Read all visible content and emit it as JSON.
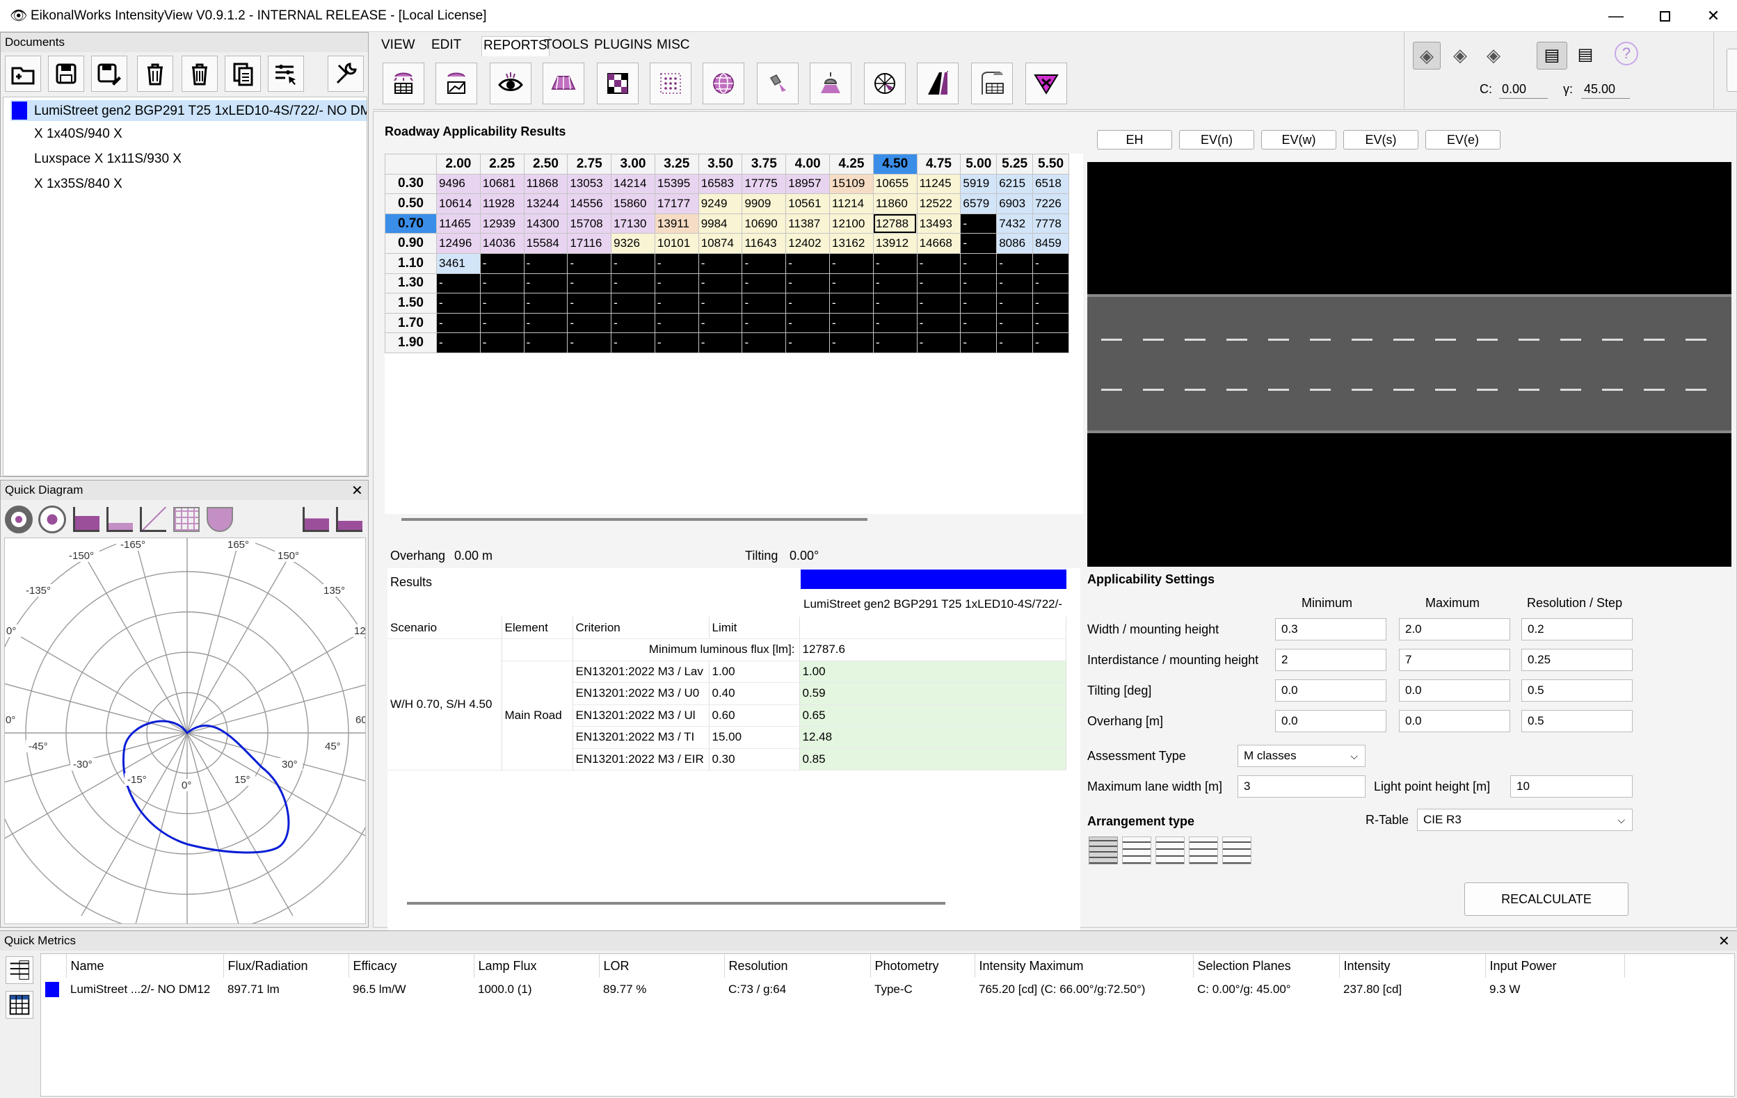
{
  "window": {
    "title": "EikonalWorks IntensityView V0.9.1.2 - INTERNAL RELEASE - [Local License]"
  },
  "menu": [
    "VIEW",
    "EDIT",
    "REPORTS",
    "TOOLS",
    "PLUGINS",
    "MISC"
  ],
  "angles": {
    "c_label": "C:",
    "c_value": "0.00",
    "g_label": "γ:",
    "g_value": "45.00"
  },
  "documents": {
    "title": "Documents",
    "items": [
      "LumiStreet gen2 BGP291 T25 1xLED10-4S/722/- NO DM",
      "X 1x40S/940 X",
      "Luxspace X 1x11S/930 X",
      "X 1x35S/840 X"
    ],
    "swatch_color": "#0000ff"
  },
  "quick_diagram": {
    "title": "Quick Diagram",
    "labels": [
      "-165°",
      "165°",
      "-150°",
      "150°",
      "-135°",
      "135°",
      "0°",
      "12",
      "0°",
      "60",
      "-45°",
      "45°",
      "-30°",
      "30°",
      "-15°",
      "0°",
      "15°"
    ]
  },
  "results_grid": {
    "title": "Roadway Applicability Results",
    "columns": [
      "2.00",
      "2.25",
      "2.50",
      "2.75",
      "3.00",
      "3.25",
      "3.50",
      "3.75",
      "4.00",
      "4.25",
      "4.50",
      "4.75",
      "5.00",
      "5.25",
      "5.50"
    ],
    "selected_column": "4.50",
    "selected_row": "0.70",
    "rows": [
      {
        "label": "0.30",
        "cells": [
          "9496",
          "10681",
          "11868",
          "13053",
          "14214",
          "15395",
          "16583",
          "17775",
          "18957",
          "15109",
          "10655",
          "11245",
          "5919",
          "6215",
          "6518"
        ]
      },
      {
        "label": "0.50",
        "cells": [
          "10614",
          "11928",
          "13244",
          "14556",
          "15860",
          "17177",
          "9249",
          "9909",
          "10561",
          "11214",
          "11860",
          "12522",
          "6579",
          "6903",
          "7226"
        ]
      },
      {
        "label": "0.70",
        "cells": [
          "11465",
          "12939",
          "14300",
          "15708",
          "17130",
          "13911",
          "9984",
          "10690",
          "11387",
          "12100",
          "12788",
          "13493",
          "-",
          "7432",
          "7778"
        ]
      },
      {
        "label": "0.90",
        "cells": [
          "12496",
          "14036",
          "15584",
          "17116",
          "9326",
          "10101",
          "10874",
          "11643",
          "12402",
          "13162",
          "13912",
          "14668",
          "-",
          "8086",
          "8459"
        ]
      },
      {
        "label": "1.10",
        "cells": [
          "3461",
          "-",
          "-",
          "-",
          "-",
          "-",
          "-",
          "-",
          "-",
          "-",
          "-",
          "-",
          "-",
          "-",
          "-"
        ]
      },
      {
        "label": "1.30",
        "cells": [
          "-",
          "-",
          "-",
          "-",
          "-",
          "-",
          "-",
          "-",
          "-",
          "-",
          "-",
          "-",
          "-",
          "-",
          "-"
        ]
      },
      {
        "label": "1.50",
        "cells": [
          "-",
          "-",
          "-",
          "-",
          "-",
          "-",
          "-",
          "-",
          "-",
          "-",
          "-",
          "-",
          "-",
          "-",
          "-"
        ]
      },
      {
        "label": "1.70",
        "cells": [
          "-",
          "-",
          "-",
          "-",
          "-",
          "-",
          "-",
          "-",
          "-",
          "-",
          "-",
          "-",
          "-",
          "-",
          "-"
        ]
      },
      {
        "label": "1.90",
        "cells": [
          "-",
          "-",
          "-",
          "-",
          "-",
          "-",
          "-",
          "-",
          "-",
          "-",
          "-",
          "-",
          "-",
          "-",
          "-"
        ]
      }
    ],
    "colors": {
      "pink": "#e8d4f0",
      "yellow": "#f8f4d4",
      "orange": "#f6dcc4",
      "blue": "#d2e4f8",
      "black": "#000000"
    }
  },
  "details": {
    "overhang_label": "Overhang",
    "overhang_value": "0.00 m",
    "tilting_label": "Tilting",
    "tilting_value": "0.00°",
    "results_label": "Results",
    "luminaire_name": "LumiStreet gen2 BGP291 T25 1xLED10-4S/722/-",
    "luminaire_color": "#0000ff",
    "headers": [
      "Scenario",
      "Element",
      "Criterion",
      "Limit"
    ],
    "min_flux_label": "Minimum luminous flux [lm]:",
    "min_flux_value": "12787.6",
    "scenario": "W/H 0.70, S/H 4.50",
    "element": "Main Road",
    "criteria": [
      {
        "criterion": "EN13201:2022 M3 / Lav",
        "limit": "1.00",
        "value": "1.00"
      },
      {
        "criterion": "EN13201:2022 M3 / U0",
        "limit": "0.40",
        "value": "0.59"
      },
      {
        "criterion": "EN13201:2022 M3 / Ul",
        "limit": "0.60",
        "value": "0.65"
      },
      {
        "criterion": "EN13201:2022 M3 / TI",
        "limit": "15.00",
        "value": "12.48"
      },
      {
        "criterion": "EN13201:2022 M3 / EIR",
        "limit": "0.30",
        "value": "0.85"
      }
    ],
    "pass_color": "#e4f6e0"
  },
  "view_tabs": [
    "EH",
    "EV(n)",
    "EV(w)",
    "EV(s)",
    "EV(e)"
  ],
  "settings": {
    "title": "Applicability Settings",
    "col_headers": [
      "Minimum",
      "Maximum",
      "Resolution / Step"
    ],
    "rows": [
      {
        "label": "Width / mounting height",
        "min": "0.3",
        "max": "2.0",
        "step": "0.2"
      },
      {
        "label": "Interdistance / mounting height",
        "min": "2",
        "max": "7",
        "step": "0.25"
      },
      {
        "label": "Tilting [deg]",
        "min": "0.0",
        "max": "0.0",
        "step": "0.5"
      },
      {
        "label": "Overhang [m]",
        "min": "0.0",
        "max": "0.0",
        "step": "0.5"
      }
    ],
    "assessment_label": "Assessment Type",
    "assessment_value": "M classes",
    "lane_width_label": "Maximum lane width [m]",
    "lane_width_value": "3",
    "light_height_label": "Light point height [m]",
    "light_height_value": "10",
    "arrangement_label": "Arrangement type",
    "rtable_label": "R-Table",
    "rtable_value": "CIE R3",
    "recalc_label": "RECALCULATE"
  },
  "quick_metrics": {
    "title": "Quick Metrics",
    "headers": [
      "Name",
      "Flux/Radiation",
      "Efficacy",
      "Lamp Flux",
      "LOR",
      "Resolution",
      "Photometry",
      "Intensity Maximum",
      "Selection Planes",
      "Intensity",
      "Input Power"
    ],
    "row": [
      "LumiStreet ...2/- NO DM12",
      "897.71 lm",
      "96.5 lm/W",
      "1000.0 (1)",
      "89.77 %",
      "C:73 / g:64",
      "Type-C",
      "765.20 [cd] (C: 66.00°/g:72.50°)",
      "C: 0.00°/g: 45.00°",
      "237.80 [cd]",
      "9.3 W"
    ],
    "swatch_color": "#0000ff"
  }
}
